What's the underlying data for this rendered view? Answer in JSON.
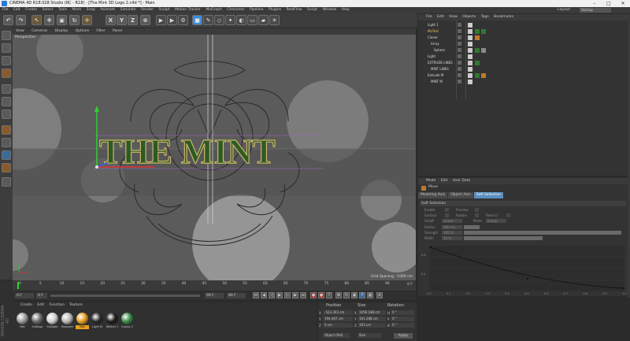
{
  "window": {
    "title": "CINEMA 4D R18.028 Studio (RC - R18) - [The Mint 3D Logo 2.c4d *] - Main",
    "controls": [
      "–",
      "□",
      "✕"
    ]
  },
  "menubar": {
    "items": [
      "File",
      "Edit",
      "Create",
      "Select",
      "Tools",
      "Mesh",
      "Snap",
      "Animate",
      "Simulate",
      "Render",
      "Sculpt",
      "Motion Tracker",
      "MoGraph",
      "Character",
      "Pipeline",
      "Plugins",
      "RealFlow",
      "Script",
      "Window",
      "Help"
    ],
    "layout_label": "Layout:",
    "layout_value": "Startup"
  },
  "toolbar": {
    "axis_buttons": [
      "X",
      "Y",
      "Z"
    ],
    "colors": {
      "cube": "#3a8de0",
      "render": "#d0d0d0"
    }
  },
  "viewport": {
    "menu": [
      "View",
      "Cameras",
      "Display",
      "Options",
      "Filter",
      "Panel"
    ],
    "label": "Perspective",
    "grid_spacing": "Grid Spacing : 1000 cm",
    "logo_text": "THE MINT",
    "colors": {
      "background": "#5b5b5b",
      "logo_fill": "#2e5a24",
      "logo_outline": "#c9b56a",
      "ornament": "#2a2a2a"
    }
  },
  "object_manager": {
    "menu": [
      "File",
      "Edit",
      "View",
      "Objects",
      "Tags",
      "Bookmarks"
    ],
    "objects": [
      {
        "name": "Light 1",
        "color": "#dddddd"
      },
      {
        "name": "MoText",
        "color": "#e8c84a"
      },
      {
        "name": "Cloner",
        "color": "#dddddd"
      },
      {
        "name": "Array",
        "color": "#dddddd"
      },
      {
        "name": "Sphere",
        "color": "#dddddd"
      },
      {
        "name": "Light",
        "color": "#dddddd"
      },
      {
        "name": "EXTRUDE LINES",
        "color": "#dddddd"
      },
      {
        "name": "MINT LINES",
        "color": "#dddddd"
      },
      {
        "name": "Extrude M",
        "color": "#dddddd"
      },
      {
        "name": "MINT M",
        "color": "#dddddd"
      }
    ]
  },
  "attributes": {
    "menu": [
      "Mode",
      "Edit",
      "User Data"
    ],
    "mode_title": "Move",
    "tabs": [
      "Modeling Axis",
      "Object Axis",
      "Soft Selection"
    ],
    "active_tab": "Soft Selection",
    "section": "Soft Selection",
    "props": {
      "enable": "Enable",
      "preview": "Preview",
      "surface": "Surface",
      "rubber": "Rubber",
      "restrict": "Restrict",
      "falloff": "Falloff",
      "falloff_value": "Linear",
      "mode": "Mode",
      "mode_value": "Group",
      "radius": "Radius",
      "radius_value": "100 cm",
      "strength": "Strength",
      "strength_value": "100 %",
      "width": "Width",
      "width_value": "50 %"
    },
    "curve_x_ticks": [
      "0.0",
      "0.1",
      "0.2",
      "0.3",
      "0.4",
      "0.5",
      "0.6",
      "0.7",
      "0.8",
      "0.9",
      "1.0"
    ],
    "curve_y_ticks": [
      "0.8",
      "0.4"
    ]
  },
  "timeline": {
    "ticks": [
      "0",
      "5",
      "10",
      "15",
      "20",
      "25",
      "30",
      "35",
      "40",
      "45",
      "50",
      "55",
      "60",
      "65",
      "70",
      "75",
      "80",
      "85",
      "90"
    ],
    "end_label": "0 F"
  },
  "transport": {
    "start": "0 F",
    "current": "0 F",
    "end": "90 F",
    "end2": "90 F"
  },
  "material_manager": {
    "menu": [
      "Create",
      "Edit",
      "Function",
      "Texture"
    ],
    "materials": [
      {
        "name": "Mat",
        "color": "#9a9a9a"
      },
      {
        "name": "Sildlogo",
        "color": "#6b6b6b"
      },
      {
        "name": "Sildlight",
        "color": "#d0d0d0"
      },
      {
        "name": "Bespoke",
        "color": "#b8b8b8"
      },
      {
        "name": "Mat",
        "color": "#e8a020"
      },
      {
        "name": "Light M",
        "color": "#2a2a2a"
      },
      {
        "name": "Reflect 1",
        "color": "#1e1e1e"
      },
      {
        "name": "Glossy 2",
        "color": "#3c8a4a"
      }
    ]
  },
  "coordinates": {
    "headers": [
      "Position",
      "Size",
      "Rotation"
    ],
    "axes": [
      {
        "axis": "X",
        "pos": "-523.303 cm",
        "size": "1056.188 cm",
        "rot_axis": "H",
        "rot": "0 °"
      },
      {
        "axis": "Y",
        "pos": "194.467 cm",
        "size": "161.288 cm",
        "rot_axis": "P",
        "rot": "0 °"
      },
      {
        "axis": "Z",
        "pos": "0 cm",
        "size": "163 cm",
        "rot_axis": "B",
        "rot": "0 °"
      }
    ],
    "object_mode": "Object (Rel)",
    "size_mode": "Size",
    "apply": "Apply"
  },
  "brand": "MAXON CINEMA 4D"
}
